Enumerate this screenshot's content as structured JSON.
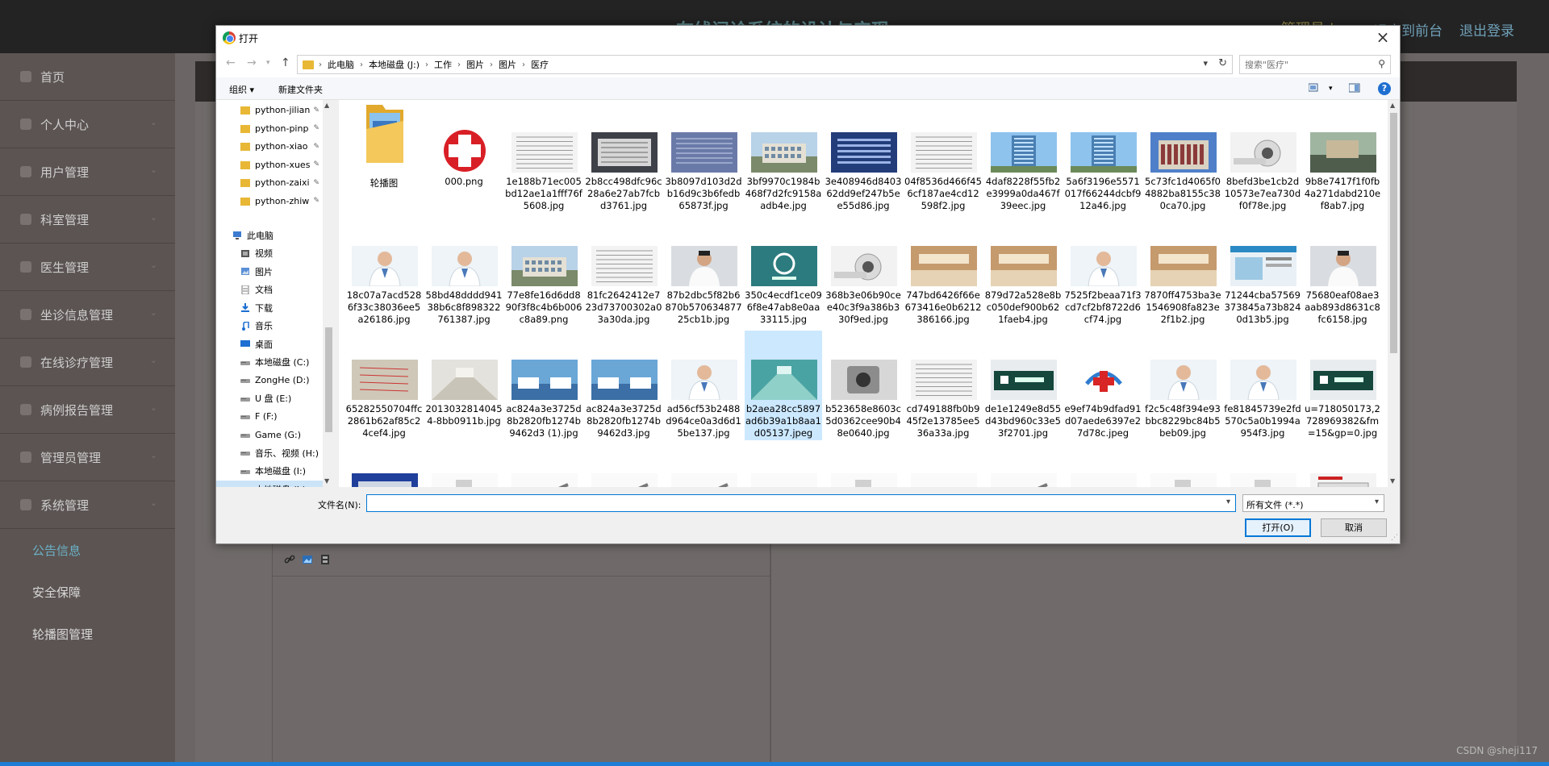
{
  "webapp": {
    "title": "在线问诊系统的设计与实现",
    "admin_label": "管理员",
    "admin_sep": "|",
    "front_link": "退出到前台",
    "logout_link": "退出登录",
    "sidebar": [
      {
        "label": "首页",
        "icon": "home-icon"
      },
      {
        "label": "个人中心",
        "icon": "user-icon"
      },
      {
        "label": "用户管理",
        "icon": "users-icon"
      },
      {
        "label": "科室管理",
        "icon": "menu-icon"
      },
      {
        "label": "医生管理",
        "icon": "chart-icon"
      },
      {
        "label": "坐诊信息管理",
        "icon": "location-icon"
      },
      {
        "label": "在线诊疗管理",
        "icon": "list-icon"
      },
      {
        "label": "病例报告管理",
        "icon": "comment-icon"
      },
      {
        "label": "管理员管理",
        "icon": "list-icon"
      },
      {
        "label": "系统管理",
        "icon": "gear-icon"
      }
    ],
    "sub_items": [
      "公告信息",
      "安全保障",
      "轮播图管理"
    ]
  },
  "watermark": "CSDN @sheji117",
  "dialog": {
    "title": "打开",
    "path": [
      "此电脑",
      "本地磁盘 (J:)",
      "工作",
      "图片",
      "图片",
      "医疗"
    ],
    "search_placeholder": "搜索\"医疗\"",
    "toolbar": {
      "organize": "组织 ▾",
      "new_folder": "新建文件夹",
      "help": "?"
    },
    "nav": [
      {
        "label": "python-jilian",
        "pinned": true,
        "type": "folder"
      },
      {
        "label": "python-pinp",
        "pinned": true,
        "type": "folder"
      },
      {
        "label": "python-xiao",
        "pinned": true,
        "type": "folder"
      },
      {
        "label": "python-xues",
        "pinned": true,
        "type": "folder"
      },
      {
        "label": "python-zaixi",
        "pinned": true,
        "type": "folder"
      },
      {
        "label": "python-zhiw",
        "pinned": true,
        "type": "folder"
      },
      {
        "label": "此电脑",
        "type": "pc"
      },
      {
        "label": "视频",
        "type": "video"
      },
      {
        "label": "图片",
        "type": "pics"
      },
      {
        "label": "文档",
        "type": "docs"
      },
      {
        "label": "下载",
        "type": "download"
      },
      {
        "label": "音乐",
        "type": "music"
      },
      {
        "label": "桌面",
        "type": "desktop"
      },
      {
        "label": "本地磁盘 (C:)",
        "type": "drive"
      },
      {
        "label": "ZongHe (D:)",
        "type": "drive"
      },
      {
        "label": "U 盘 (E:)",
        "type": "drive"
      },
      {
        "label": "F (F:)",
        "type": "drive"
      },
      {
        "label": "Game (G:)",
        "type": "drive"
      },
      {
        "label": "音乐、视频 (H:)",
        "type": "drive"
      },
      {
        "label": "本地磁盘 (I:)",
        "type": "drive"
      },
      {
        "label": "本地磁盘 (J:)",
        "type": "drive",
        "selected": true
      }
    ],
    "files": [
      {
        "name": "轮播图",
        "kind": "folder"
      },
      {
        "name": "000.png",
        "kind": "cross"
      },
      {
        "name": "1e188b71ec005bd12ae1a1fff76f5608.jpg",
        "kind": "doc"
      },
      {
        "name": "2b8cc498dfc96c28a6e27ab7fcbd3761.jpg",
        "kind": "paper"
      },
      {
        "name": "3b8097d103d2db16d9c3b6fedb65873f.jpg",
        "kind": "paper2"
      },
      {
        "name": "3bf9970c1984b468f7d2fc9158aadb4e.jpg",
        "kind": "building"
      },
      {
        "name": "3e408946d840362dd9ef247b5ee55d86.jpg",
        "kind": "blue"
      },
      {
        "name": "04f8536d466f456cf187ae4cd12598f2.jpg",
        "kind": "doc"
      },
      {
        "name": "4daf8228f55fb2e3999a0da467f39eec.jpg",
        "kind": "tower"
      },
      {
        "name": "5a6f3196e5571017f66244dcbf912a46.jpg",
        "kind": "tower"
      },
      {
        "name": "5c73fc1d4065f04882ba8155c380ca70.jpg",
        "kind": "building2"
      },
      {
        "name": "8befd3be1cb2d10573e7ea730df0f78e.jpg",
        "kind": "machine"
      },
      {
        "name": "9b8e7417f1f0fb4a271dabd210ef8ab7.jpg",
        "kind": "street"
      },
      {
        "name": "18c07a7acd5286f33c38036ee5a26186.jpg",
        "kind": "doctor"
      },
      {
        "name": "58bd48dddd94138b6c8f898322761387.jpg",
        "kind": "doctor"
      },
      {
        "name": "77e8fe16d6dd890f3f8c4b6b006c8a89.png",
        "kind": "building"
      },
      {
        "name": "81fc2642412e723d73700302a03a30da.jpg",
        "kind": "doc"
      },
      {
        "name": "87b2dbc5f82b6870b57063487725cb1b.jpg",
        "kind": "doctor2"
      },
      {
        "name": "350c4ecdf1ce096f8e47ab8e0aa33115.jpg",
        "kind": "logo"
      },
      {
        "name": "368b3e06b90cee40c3f9a386b330f9ed.jpg",
        "kind": "machine"
      },
      {
        "name": "747bd6426f66e673416e0b6212386166.jpg",
        "kind": "hall"
      },
      {
        "name": "879d72a528e8bc050def900b621faeb4.jpg",
        "kind": "hall"
      },
      {
        "name": "7525f2beaa71f3cd7cf2bf8722d6cf74.jpg",
        "kind": "doctor"
      },
      {
        "name": "7870ff4753ba3e1546908fa823e2f1b2.jpg",
        "kind": "hall"
      },
      {
        "name": "71244cba57569373845a73b8240d13b5.jpg",
        "kind": "web"
      },
      {
        "name": "75680eaf08ae3aab893d8631c8fc6158.jpg",
        "kind": "doctor2"
      },
      {
        "name": "65282550704ffc2861b62af85c24cef4.jpg",
        "kind": "paper3"
      },
      {
        "name": "20130328140454-8bb0911b.jpg",
        "kind": "ward"
      },
      {
        "name": "ac824a3e3725d8b2820fb1274b9462d3 (1).jpg",
        "kind": "ward2"
      },
      {
        "name": "ac824a3e3725d8b2820fb1274b9462d3.jpg",
        "kind": "ward2"
      },
      {
        "name": "ad56cf53b2488d964ce0a3d6d15be137.jpg",
        "kind": "doctor"
      },
      {
        "name": "b2aea28cc5897ad6b39a1b8aa1d05137.jpeg",
        "kind": "corridor",
        "selected": true
      },
      {
        "name": "b523658e8603c5d0362cee90b48e0640.jpg",
        "kind": "machine2"
      },
      {
        "name": "cd749188fb0b945f2e13785ee536a33a.jpg",
        "kind": "doc"
      },
      {
        "name": "de1e1249e8d55d43bd960c33e53f2701.jpg",
        "kind": "sign"
      },
      {
        "name": "e9ef74b9dfad91d07aede6397e27d78c.jpeg",
        "kind": "cross2"
      },
      {
        "name": "f2c5c48f394e93bbc8229bc84b5beb09.jpg",
        "kind": "doctor"
      },
      {
        "name": "fe81845739e2fd570c5a0b1994a954f3.jpg",
        "kind": "doctor"
      },
      {
        "name": "u=718050173,2728969382&fm=15&gp=0.jpg",
        "kind": "sign"
      },
      {
        "name": "",
        "kind": "kit"
      },
      {
        "name": "",
        "kind": "device"
      },
      {
        "name": "",
        "kind": "tool"
      },
      {
        "name": "",
        "kind": "tool"
      },
      {
        "name": "",
        "kind": "tool"
      },
      {
        "name": "",
        "kind": "dark"
      },
      {
        "name": "",
        "kind": "device"
      },
      {
        "name": "",
        "kind": "greensign"
      },
      {
        "name": "",
        "kind": "tool"
      },
      {
        "name": "",
        "kind": "dark"
      },
      {
        "name": "",
        "kind": "device"
      },
      {
        "name": "",
        "kind": "device"
      },
      {
        "name": "",
        "kind": "redscreen"
      }
    ],
    "filename_label": "文件名(N):",
    "filename_value": "",
    "filetype": "所有文件 (*.*)",
    "open_button": "打开(O)",
    "cancel_button": "取消"
  }
}
